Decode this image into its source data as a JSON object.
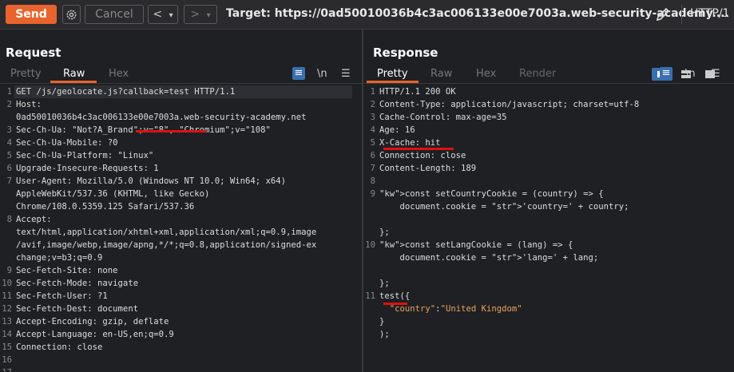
{
  "toolbar": {
    "send_label": "Send",
    "cancel_label": "Cancel",
    "back_glyph": "<",
    "forward_glyph": ">",
    "dropdown_glyph": "▾",
    "target_text": "Target: https://0ad50010036b4c3ac006133e00e7003a.web-security-academy....",
    "http_version": "HTTP/1"
  },
  "request": {
    "title": "Request",
    "tabs": [
      "Pretty",
      "Raw",
      "Hex"
    ],
    "active_tab": "Raw",
    "lines": [
      {
        "n": "1",
        "text": "GET /js/geolocate.js?callback=test HTTP/1.1"
      },
      {
        "n": "2",
        "text": "Host:"
      },
      {
        "n": "",
        "text": "0ad50010036b4c3ac006133e00e7003a.web-security-academy.net"
      },
      {
        "n": "3",
        "text": "Sec-Ch-Ua: \"Not?A_Brand\";v=\"8\", \"Chromium\";v=\"108\""
      },
      {
        "n": "4",
        "text": "Sec-Ch-Ua-Mobile: ?0"
      },
      {
        "n": "5",
        "text": "Sec-Ch-Ua-Platform: \"Linux\""
      },
      {
        "n": "6",
        "text": "Upgrade-Insecure-Requests: 1"
      },
      {
        "n": "7",
        "text": "User-Agent: Mozilla/5.0 (Windows NT 10.0; Win64; x64)"
      },
      {
        "n": "",
        "text": "AppleWebKit/537.36 (KHTML, like Gecko)"
      },
      {
        "n": "",
        "text": "Chrome/108.0.5359.125 Safari/537.36"
      },
      {
        "n": "8",
        "text": "Accept:"
      },
      {
        "n": "",
        "text": "text/html,application/xhtml+xml,application/xml;q=0.9,image"
      },
      {
        "n": "",
        "text": "/avif,image/webp,image/apng,*/*;q=0.8,application/signed-ex"
      },
      {
        "n": "",
        "text": "change;v=b3;q=0.9"
      },
      {
        "n": "9",
        "text": "Sec-Fetch-Site: none"
      },
      {
        "n": "10",
        "text": "Sec-Fetch-Mode: navigate"
      },
      {
        "n": "11",
        "text": "Sec-Fetch-User: ?1"
      },
      {
        "n": "12",
        "text": "Sec-Fetch-Dest: document"
      },
      {
        "n": "13",
        "text": "Accept-Encoding: gzip, deflate"
      },
      {
        "n": "14",
        "text": "Accept-Language: en-US,en;q=0.9"
      },
      {
        "n": "15",
        "text": "Connection: close"
      },
      {
        "n": "16",
        "text": ""
      },
      {
        "n": "17",
        "text": ""
      }
    ]
  },
  "response": {
    "title": "Response",
    "tabs": [
      "Pretty",
      "Raw",
      "Hex",
      "Render"
    ],
    "active_tab": "Pretty",
    "lines": [
      {
        "n": "1",
        "text": "HTTP/1.1 200 OK"
      },
      {
        "n": "2",
        "text": "Content-Type: application/javascript; charset=utf-8"
      },
      {
        "n": "3",
        "text": "Cache-Control: max-age=35"
      },
      {
        "n": "4",
        "text": "Age: 16"
      },
      {
        "n": "5",
        "text": "X-Cache: hit"
      },
      {
        "n": "6",
        "text": "Connection: close"
      },
      {
        "n": "7",
        "text": "Content-Length: 189"
      },
      {
        "n": "8",
        "text": ""
      },
      {
        "n": "9",
        "text": "const setCountryCookie = (country) => {"
      },
      {
        "n": "",
        "text": "    document.cookie = 'country=' + country;"
      },
      {
        "n": "",
        "text": ""
      },
      {
        "n": "",
        "text": "};"
      },
      {
        "n": "10",
        "text": "const setLangCookie = (lang) => {"
      },
      {
        "n": "",
        "text": "    document.cookie = 'lang=' + lang;"
      },
      {
        "n": "",
        "text": ""
      },
      {
        "n": "",
        "text": "};"
      },
      {
        "n": "11",
        "text": "test({"
      },
      {
        "n": "",
        "text": "  \"country\":\"United Kingdom\""
      },
      {
        "n": "",
        "text": "}"
      },
      {
        "n": "",
        "text": ");"
      }
    ]
  },
  "colors": {
    "accent": "#e8642c",
    "annotation": "#e01010",
    "toggle_active": "#3a6fb0"
  }
}
